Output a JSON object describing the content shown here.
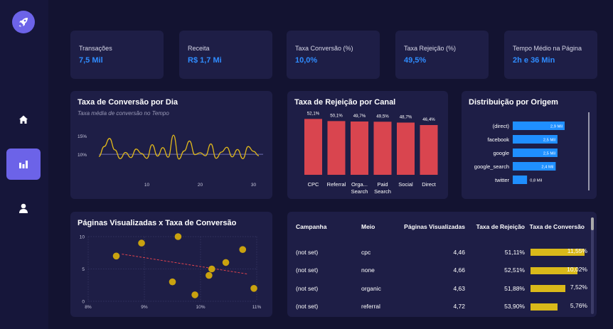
{
  "kpis": [
    {
      "label": "Transações",
      "value": "7,5 Mil"
    },
    {
      "label": "Receita",
      "value": "R$ 1,7 Mi"
    },
    {
      "label": "Taxa Conversão (%)",
      "value": "10,0%"
    },
    {
      "label": "Taxa Rejeição (%)",
      "value": "49,5%"
    },
    {
      "label": "Tempo Médio na Página",
      "value": "2h e 36 Min"
    }
  ],
  "nav": {
    "icons": [
      "rocket-icon",
      "home-icon",
      "bar-chart-icon",
      "user-icon"
    ]
  },
  "colors": {
    "accent": "#6c63e8",
    "kpi_value": "#2f8cff",
    "rejection_bar": "#d9454f",
    "origin_bar": "#1f8fff",
    "conversion": "#e0b81c"
  },
  "conversion_chart": {
    "title": "Taxa de Conversão por Dia",
    "subtitle": "Taxa média de conversão no Tempo"
  },
  "rejection_chart": {
    "title": "Taxa de Rejeição por Canal"
  },
  "origin_chart": {
    "title": "Distribuição por Origem"
  },
  "scatter_chart": {
    "title": "Páginas Visualizadas x Taxa de Conversão"
  },
  "chart_data": [
    {
      "type": "line",
      "title": "Taxa de Conversão por Dia",
      "subtitle": "Taxa média de conversão no Tempo",
      "x": [
        1,
        2,
        3,
        4,
        5,
        6,
        7,
        8,
        9,
        10,
        11,
        12,
        13,
        14,
        15,
        16,
        17,
        18,
        19,
        20,
        21,
        22,
        23,
        24,
        25,
        26,
        27,
        28,
        29,
        30,
        31
      ],
      "values": [
        9.4,
        12.1,
        14.3,
        11.2,
        8.8,
        10.5,
        9.1,
        11.4,
        10.2,
        8.9,
        12.6,
        9.5,
        11.8,
        9.2,
        15.2,
        8.7,
        10.9,
        13.6,
        9.9,
        10.4,
        9.6,
        12.8,
        8.9,
        10.6,
        11.9,
        9.3,
        11.3,
        8.8,
        12.1,
        10.8,
        9.6
      ],
      "yticks": [
        "15%",
        "10%"
      ],
      "xticks": [
        "10",
        "20",
        "30"
      ],
      "average": 10.0,
      "ylim": [
        5,
        16
      ]
    },
    {
      "type": "bar",
      "title": "Taxa de Rejeição por Canal",
      "categories": [
        [
          "CPC"
        ],
        [
          "Referral"
        ],
        [
          "Orga...",
          "Search"
        ],
        [
          "Paid",
          "Search"
        ],
        [
          "Social"
        ],
        [
          "Direct"
        ]
      ],
      "values": [
        52.1,
        50.1,
        49.7,
        49.5,
        48.7,
        46.4
      ],
      "data_labels": [
        "52,1%",
        "50,1%",
        "49,7%",
        "49,5%",
        "48,7%",
        "46,4%"
      ],
      "ylim": [
        0,
        55
      ]
    },
    {
      "type": "bar",
      "orientation": "horizontal",
      "title": "Distribuição por Origem",
      "categories": [
        "(direct)",
        "facebook",
        "google",
        "google_search",
        "twitter"
      ],
      "values": [
        2.9,
        2.5,
        2.5,
        2.4,
        0.8
      ],
      "data_labels": [
        "2,9 Mil",
        "2,5 Mil",
        "2,5 Mil",
        "2,4 Mil",
        "0,8 Mil"
      ]
    },
    {
      "type": "scatter",
      "title": "Páginas Visualizadas x Taxa de Conversão",
      "points": [
        [
          8.5,
          7
        ],
        [
          8.95,
          9
        ],
        [
          9.6,
          10
        ],
        [
          9.5,
          3
        ],
        [
          9.9,
          1
        ],
        [
          10.15,
          4
        ],
        [
          10.2,
          5
        ],
        [
          10.45,
          6
        ],
        [
          10.75,
          8
        ],
        [
          10.95,
          2
        ]
      ],
      "trend": [
        [
          8.6,
          7.3
        ],
        [
          10.85,
          4.2
        ]
      ],
      "xticks": [
        "8%",
        "9%",
        "10%",
        "11%"
      ],
      "yticks": [
        "10",
        "5",
        "0"
      ],
      "xlim": [
        8,
        11
      ],
      "ylim": [
        0,
        10
      ]
    }
  ],
  "table": {
    "headers": [
      "Campanha",
      "Meio",
      "Páginas Visualizadas",
      "Taxa de Rejeição",
      "Taxa de Conversão"
    ],
    "rows": [
      {
        "campanha": "(not set)",
        "meio": "cpc",
        "paginas": "4,46",
        "rejeicao": "51,11%",
        "conversao": "11,55%",
        "conversao_value": 11.55
      },
      {
        "campanha": "(not set)",
        "meio": "none",
        "paginas": "4,66",
        "rejeicao": "52,51%",
        "conversao": "10,02%",
        "conversao_value": 10.02
      },
      {
        "campanha": "(not set)",
        "meio": "organic",
        "paginas": "4,63",
        "rejeicao": "51,88%",
        "conversao": "7,52%",
        "conversao_value": 7.52
      },
      {
        "campanha": "(not set)",
        "meio": "referral",
        "paginas": "4,72",
        "rejeicao": "53,90%",
        "conversao": "5,76%",
        "conversao_value": 5.76
      }
    ],
    "conversion_max": 11.55
  }
}
